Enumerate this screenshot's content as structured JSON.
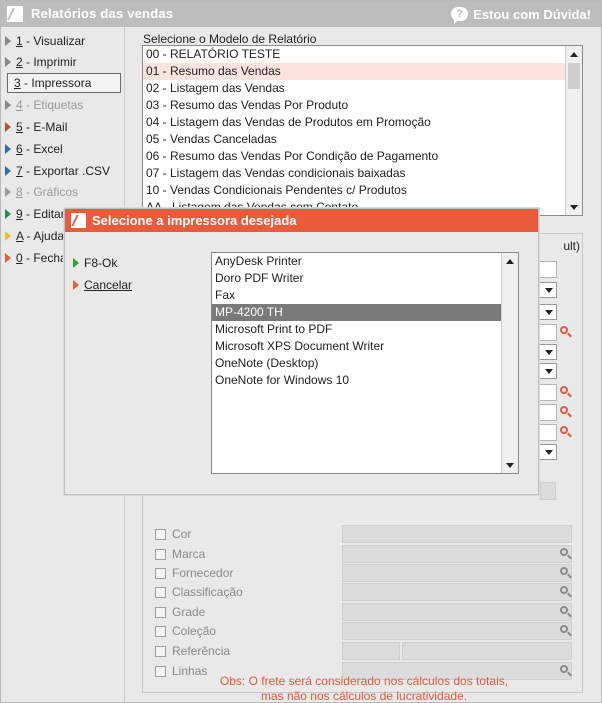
{
  "window": {
    "title": "Relatórios das vendas",
    "help_label": "Estou com Dúvida!",
    "help_glyph": "?",
    "accent": "#e85c3c",
    "title_bg": "#bdbdbd"
  },
  "sidebar": {
    "items": [
      {
        "key": "1",
        "label": " - Visualizar",
        "arrow_color": "#888888",
        "state": "normal"
      },
      {
        "key": "2",
        "label": " - Imprimir",
        "arrow_color": "#888888",
        "state": "normal"
      },
      {
        "key": "3",
        "label": " - Impressora",
        "arrow_color": "#888888",
        "state": "selected"
      },
      {
        "key": "4",
        "label": " - Etiquetas",
        "arrow_color": "#888888",
        "state": "disabled"
      },
      {
        "key": "5",
        "label": " - E-Mail",
        "arrow_color": "#b5522f",
        "state": "normal"
      },
      {
        "key": "6",
        "label": " - Excel",
        "arrow_color": "#2c6fa3",
        "state": "normal"
      },
      {
        "key": "7",
        "label": " - Exportar .CSV",
        "arrow_color": "#2c6fa3",
        "state": "normal"
      },
      {
        "key": "8",
        "label": " - Gráficos",
        "arrow_color": "#9a9a9a",
        "state": "disabled"
      },
      {
        "key": "9",
        "label": " - Editar",
        "arrow_color": "#2e8a55",
        "state": "normal"
      },
      {
        "key": "A",
        "label": " - Ajuda",
        "arrow_color": "#e2c23a",
        "state": "normal"
      },
      {
        "key": "0",
        "label": " - Fechar",
        "arrow_color": "#e85c3c",
        "state": "normal"
      }
    ]
  },
  "report_model": {
    "label": "Selecione o Modelo de Relatório",
    "items": [
      "00 - RELATÓRIO TESTE",
      "01 - Resumo das Vendas",
      "02 - Listagem das Vendas",
      "03 - Resumo das Vendas Por Produto",
      "04 - Listagem das Vendas de Produtos em Promoção",
      "05 - Vendas Canceladas",
      "06 - Resumo das Vendas Por Condição de Pagamento",
      "07 - Listagem das Vendas condicionais baixadas",
      "10 - Vendas Condicionais Pendentes c/ Produtos",
      "AA - Listagem das Vendas com Contato"
    ],
    "selected_index": 1
  },
  "filters": {
    "header_tail": "ult)",
    "checkbox_filters": [
      "Cor",
      "Marca",
      "Fornecedor",
      "Classificação",
      "Grade",
      "Coleção",
      "Referência",
      "Linhas"
    ],
    "note_line1": "Obs: O frete será considerado nos cálculos dos totais,",
    "note_line2": "mas não nos cálculos de lucratividade."
  },
  "printer_dialog": {
    "title": "Selecione a impressora desejada",
    "ok_label": "F8-Ok",
    "cancel_label": "Cancelar",
    "printers": [
      "AnyDesk Printer",
      "Doro PDF Writer",
      "Fax",
      "MP-4200 TH",
      "Microsoft Print to PDF",
      "Microsoft XPS Document Writer",
      "OneNote (Desktop)",
      "OneNote for Windows 10"
    ],
    "selected_index": 3
  }
}
